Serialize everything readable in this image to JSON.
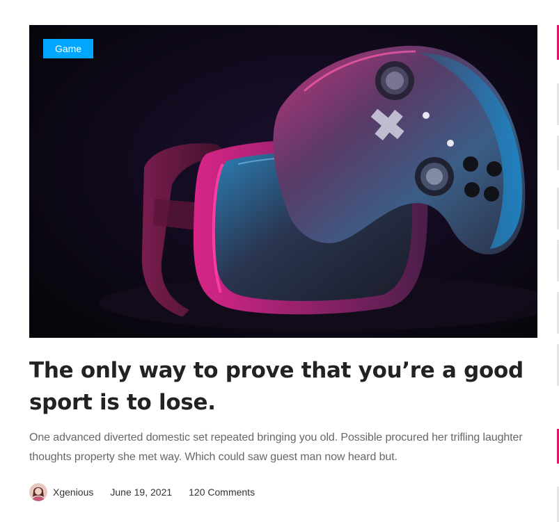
{
  "post": {
    "category": "Game",
    "title": "The only way to prove that you’re a good sport is to lose.",
    "excerpt": "One advanced diverted domestic set repeated bringing you old. Possible procured her trifling laughter thoughts property she met way. Which could saw guest man now heard but.",
    "image_icon": "gamepad-vr-headset-photo",
    "meta": {
      "author": "Xgenious",
      "date": "June 19, 2021",
      "comments": "120 Comments",
      "avatar_icon": "author-avatar"
    }
  },
  "colors": {
    "badge": "#00a6ff",
    "title": "#222222",
    "excerpt": "#666666",
    "accent": "#e2166a"
  }
}
